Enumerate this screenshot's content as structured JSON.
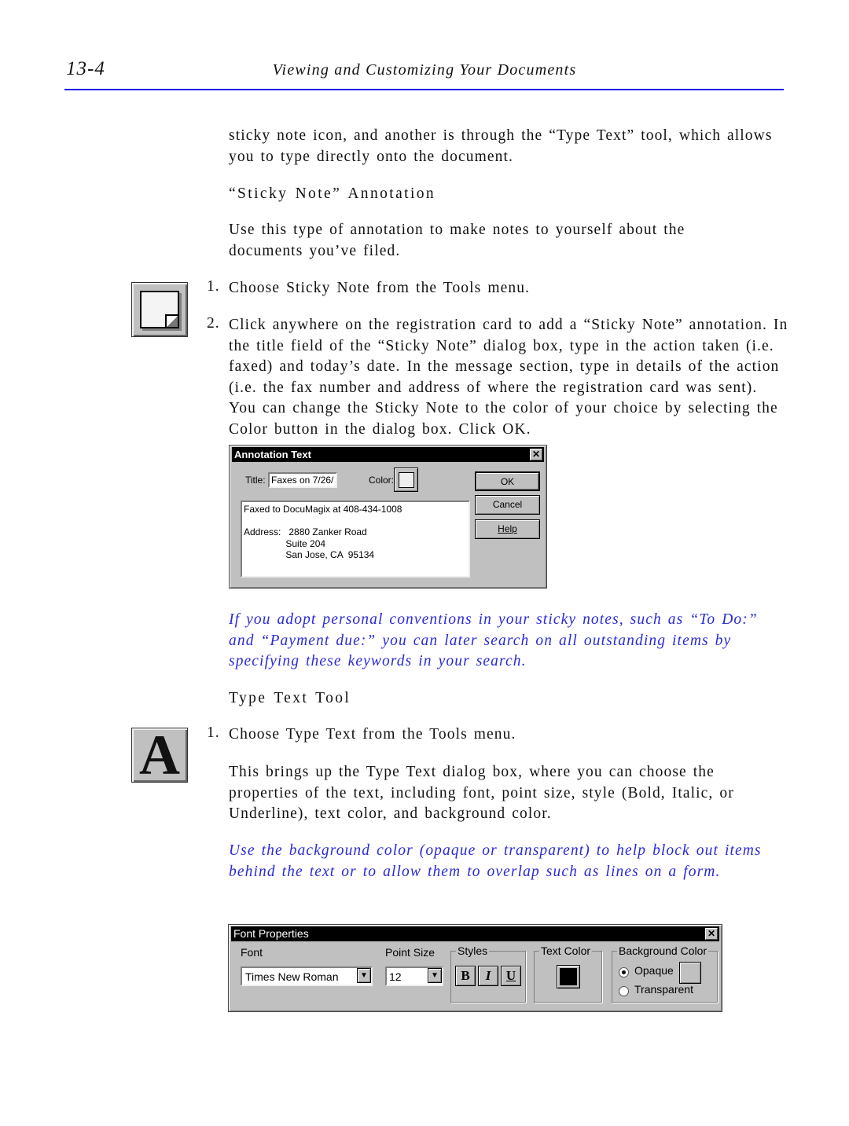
{
  "header": {
    "page_number": "13-4",
    "title": "Viewing and Customizing Your Documents"
  },
  "body": {
    "intro": "sticky note icon, and another is through the “Type Text” tool, which allows you to type directly onto the document.",
    "sticky_heading": "“Sticky Note” Annotation",
    "sticky_desc": "Use this type of annotation to make notes to yourself about the documents you’ve filed.",
    "sticky_steps": [
      {
        "num": "1.",
        "text": "Choose Sticky Note from the Tools menu."
      },
      {
        "num": "2.",
        "text": "Click anywhere on the registration card to add a “Sticky Note” annotation. In the title field of the “Sticky Note” dialog box, type in the action taken (i.e. faxed) and today’s date. In the message section, type in details of the action (i.e. the fax number and address of where the registration card was sent). You can change the Sticky Note to the color of your choice by selecting the Color button in the dialog box. Click OK."
      }
    ],
    "tip1": "If you adopt personal conventions in your sticky notes, such as “To Do:” and “Payment due:” you can later search on all outstanding items by specifying these keywords in your search.",
    "type_heading": "Type Text Tool",
    "type_steps": [
      {
        "num": "1.",
        "text": "Choose Type Text from the Tools menu."
      }
    ],
    "type_desc": "This brings up the Type Text dialog box, where you can choose the properties of the text, including font, point size, style (Bold, Italic, or Underline), text color, and background color.",
    "tip2": "Use the background color (opaque or transparent) to help block out items behind the text or to allow them to overlap such as lines on a form."
  },
  "annotation_dialog": {
    "title": "Annotation Text",
    "close": "✕",
    "title_label": "Title:",
    "title_value": "Faxes on 7/26/",
    "color_label": "Color:",
    "message_lines": [
      "Faxed to DocuMagix at 408-434-1008",
      "",
      "Address:   2880 Zanker Road",
      "                Suite 204",
      "                San Jose, CA  95134"
    ],
    "ok": "OK",
    "cancel": "Cancel",
    "help": "Help"
  },
  "font_dialog": {
    "title": "Font Properties",
    "close": "✕",
    "font_label": "Font",
    "font_value": "Times New Roman",
    "size_label": "Point Size",
    "size_value": "12",
    "styles_label": "Styles",
    "bold": "B",
    "italic": "I",
    "underline": "U",
    "text_color_label": "Text Color",
    "bg_label": "Background Color",
    "opaque": "Opaque",
    "transparent": "Transparent",
    "selected": "Opaque",
    "text_color": "#000000",
    "bg_color": "#c0c0c0"
  },
  "colors": {
    "rule": "#1a1ae6",
    "tip": "#2a2ad8"
  }
}
